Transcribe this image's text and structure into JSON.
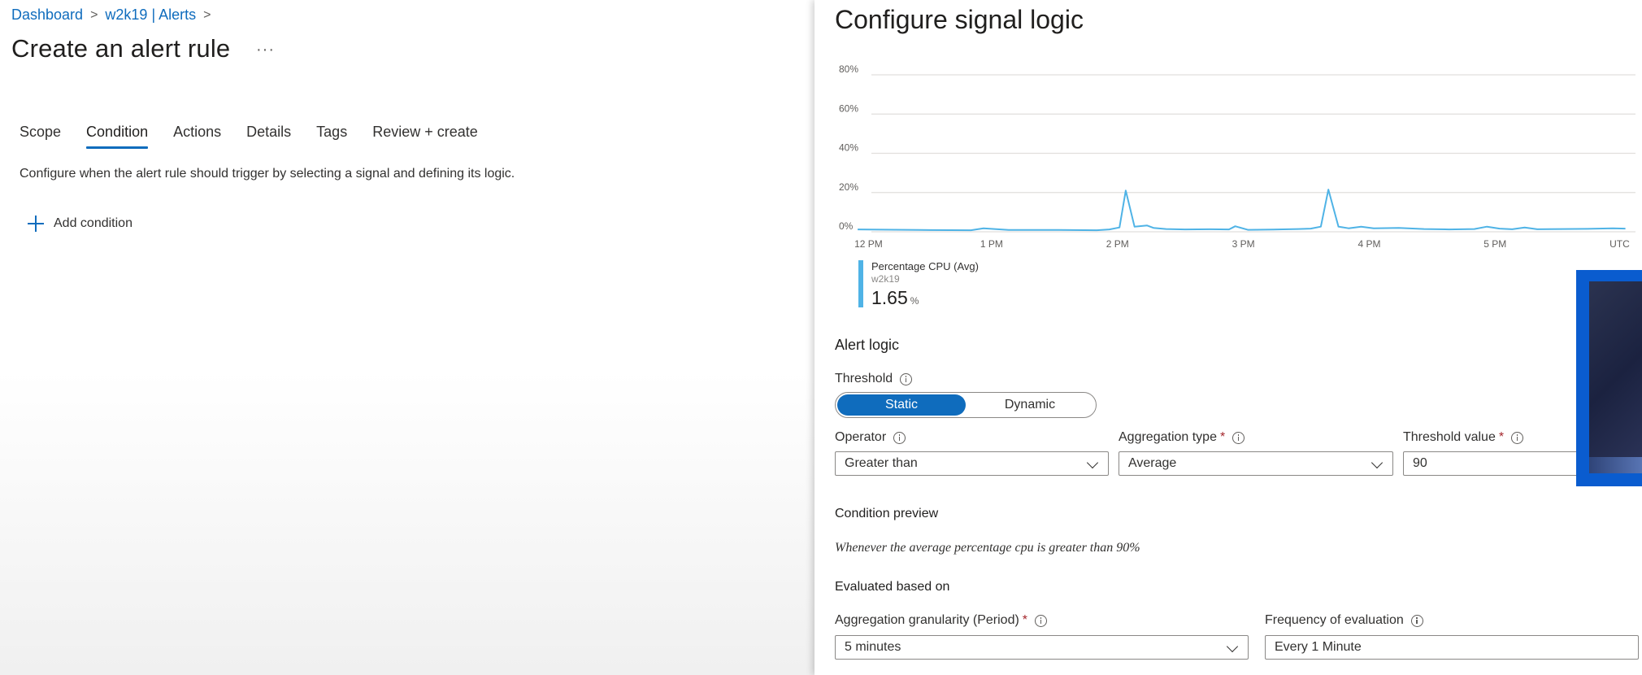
{
  "breadcrumb": {
    "items": [
      "Dashboard",
      "w2k19 | Alerts"
    ],
    "separator": ">"
  },
  "page": {
    "title": "Create an alert rule",
    "more_label": "···"
  },
  "tabs": [
    "Scope",
    "Condition",
    "Actions",
    "Details",
    "Tags",
    "Review + create"
  ],
  "active_tab": "Condition",
  "condition_tab": {
    "description": "Configure when the alert rule should trigger by selecting a signal and defining its logic.",
    "add_condition_label": "Add condition"
  },
  "panel": {
    "title": "Configure signal logic",
    "legend": {
      "metric": "Percentage CPU (Avg)",
      "resource": "w2k19",
      "value": "1.65",
      "unit": "%"
    },
    "alert_logic": {
      "heading": "Alert logic",
      "threshold_label": "Threshold",
      "threshold_options": [
        "Static",
        "Dynamic"
      ],
      "threshold_selected": "Static",
      "operator_label": "Operator",
      "operator_value": "Greater than",
      "aggregation_label": "Aggregation type",
      "aggregation_value": "Average",
      "threshold_value_label": "Threshold value",
      "threshold_value": "90",
      "required_mark": "*"
    },
    "condition_preview": {
      "heading": "Condition preview",
      "text": "Whenever the average percentage cpu is greater than 90%"
    },
    "evaluated": {
      "heading": "Evaluated based on",
      "granularity_label": "Aggregation granularity (Period)",
      "granularity_value": "5 minutes",
      "frequency_label": "Frequency of evaluation",
      "frequency_value": "Every 1 Minute"
    }
  },
  "colors": {
    "accent": "#0f6cbd",
    "line": "#4fb3e6",
    "required": "#a4262c"
  },
  "chart_data": {
    "type": "line",
    "y_ticks": [
      "80%",
      "60%",
      "40%",
      "20%",
      "0%"
    ],
    "ylim": [
      0,
      80
    ],
    "x_ticks": [
      "12 PM",
      "1 PM",
      "2 PM",
      "3 PM",
      "4 PM",
      "5 PM",
      "UTC"
    ],
    "series": [
      {
        "name": "Percentage CPU (Avg)",
        "color": "#4fb3e6",
        "x": [
          12.0,
          12.5,
          12.9,
          13.0,
          13.2,
          13.6,
          13.9,
          14.0,
          14.08,
          14.13,
          14.2,
          14.3,
          14.35,
          14.45,
          14.6,
          14.8,
          14.95,
          15.0,
          15.1,
          15.3,
          15.5,
          15.6,
          15.68,
          15.74,
          15.82,
          15.9,
          16.0,
          16.1,
          16.3,
          16.5,
          16.7,
          16.9,
          17.0,
          17.1,
          17.2,
          17.3,
          17.4,
          17.6,
          17.8,
          18.0,
          18.1
        ],
        "y": [
          1.2,
          0.9,
          0.8,
          1.8,
          0.9,
          0.9,
          0.8,
          1.2,
          2.2,
          21.0,
          2.6,
          3.2,
          2.0,
          1.4,
          1.2,
          1.3,
          1.2,
          2.8,
          1.0,
          1.1,
          1.4,
          1.6,
          2.6,
          21.5,
          2.6,
          1.8,
          2.6,
          1.8,
          2.0,
          1.4,
          1.2,
          1.4,
          2.6,
          1.6,
          1.3,
          2.2,
          1.3,
          1.4,
          1.5,
          1.8,
          1.6
        ]
      }
    ],
    "x_range_hours": [
      11.98,
      18.18
    ],
    "grid": true
  }
}
